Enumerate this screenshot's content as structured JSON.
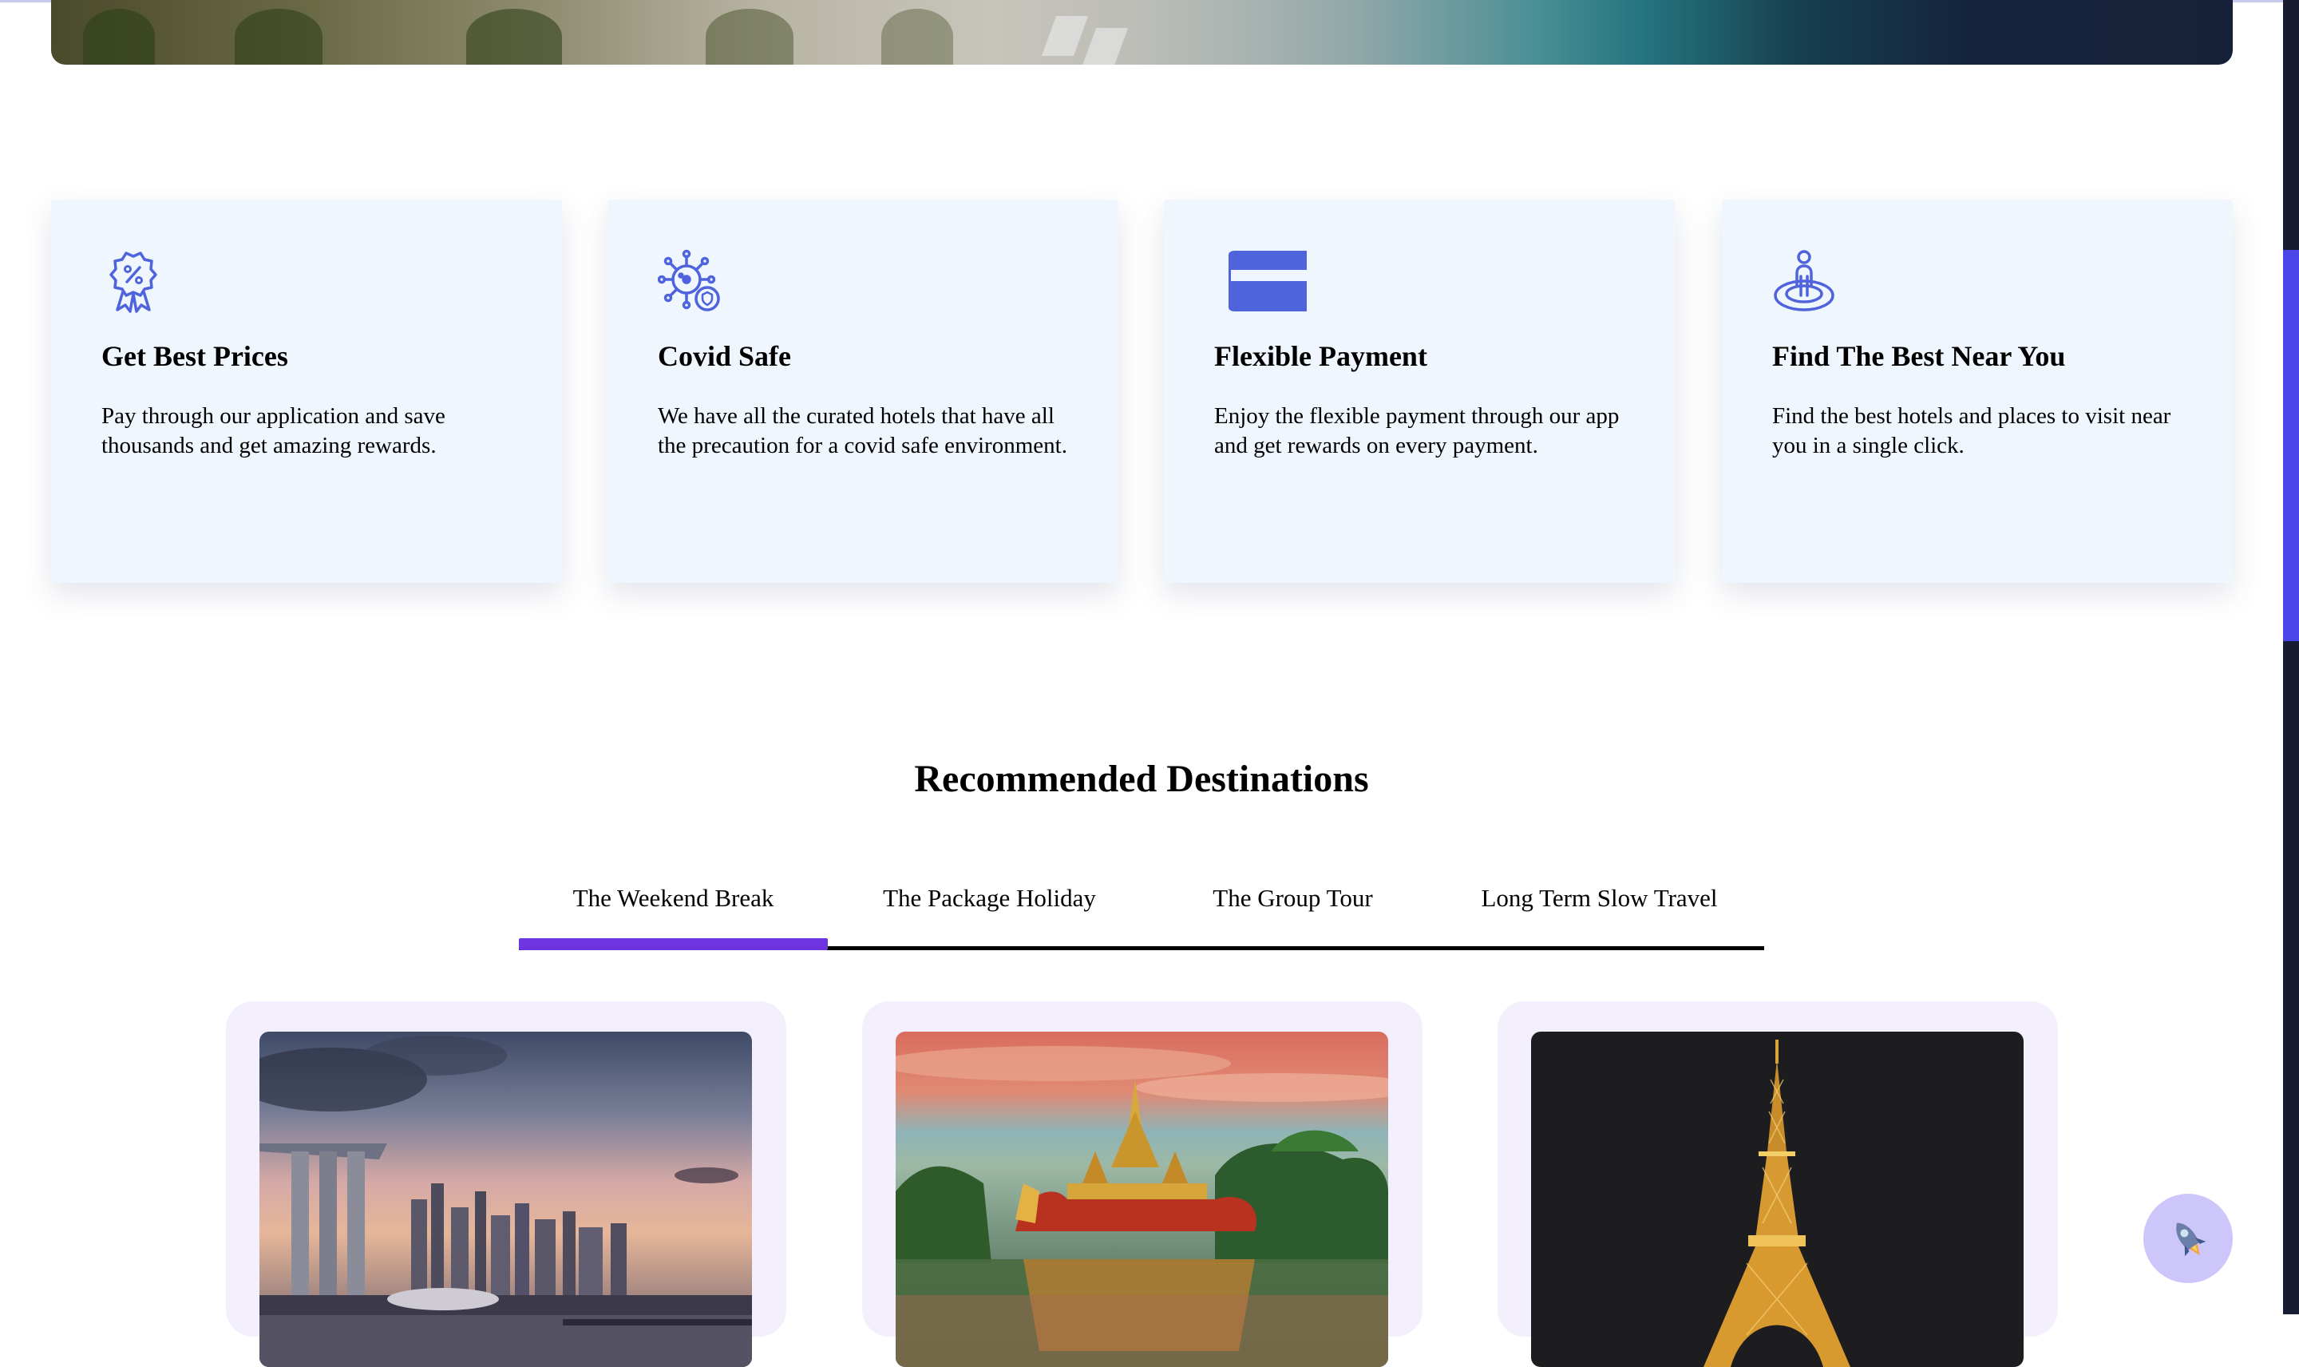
{
  "features": [
    {
      "icon": "discount-badge-icon",
      "title": "Get Best Prices",
      "text": "Pay through our application and save thousands and get amazing rewards."
    },
    {
      "icon": "virus-shield-icon",
      "title": "Covid Safe",
      "text": "We have all the curated hotels that have all the precaution for a covid safe environment."
    },
    {
      "icon": "credit-card-icon",
      "title": "Flexible Payment",
      "text": "Enjoy the flexible payment through our app and get rewards on every payment."
    },
    {
      "icon": "location-person-icon",
      "title": "Find The Best Near You",
      "text": "Find the best hotels and places to visit near you in a single click."
    }
  ],
  "section": {
    "title": "Recommended Destinations"
  },
  "tabs": [
    {
      "label": "The Weekend Break",
      "active": true
    },
    {
      "label": "The Package Holiday",
      "active": false
    },
    {
      "label": "The Group Tour",
      "active": false
    },
    {
      "label": "Long Term Slow Travel",
      "active": false
    }
  ],
  "colors": {
    "accent": "#4f63dd",
    "tab_active": "#6e34df",
    "card_bg": "#eff6fd",
    "dest_bg": "#f3effc",
    "fab_bg": "#cdc6fb"
  }
}
